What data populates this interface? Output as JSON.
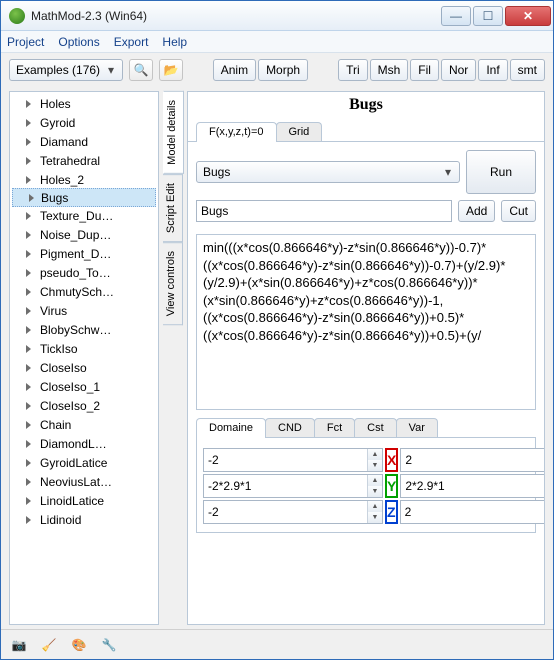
{
  "window": {
    "title": "MathMod-2.3 (Win64)"
  },
  "menu": {
    "project": "Project",
    "options": "Options",
    "export": "Export",
    "help": "Help"
  },
  "toolbar": {
    "examples_label": "Examples (176)",
    "anim": "Anim",
    "morph": "Morph",
    "tri": "Tri",
    "msh": "Msh",
    "fil": "Fil",
    "nor": "Nor",
    "inf": "Inf",
    "smt": "smt"
  },
  "tree": {
    "items": [
      "Holes",
      "Gyroid",
      "Diamand",
      "Tetrahedral",
      "Holes_2",
      "Bugs",
      "Texture_Du…",
      "Noise_Dup…",
      "Pigment_D…",
      "pseudo_To…",
      "ChmutySch…",
      "Virus",
      "BlobySchw…",
      "TickIso",
      "CloseIso",
      "CloseIso_1",
      "CloseIso_2",
      "Chain",
      "DiamondL…",
      "GyroidLatice",
      "NeoviusLat…",
      "LinoidLatice",
      "Lidinoid"
    ],
    "selected_index": 5
  },
  "sidetabs": {
    "model_details": "Model details",
    "script_edit": "Script Edit",
    "view_controls": "View controls"
  },
  "panel": {
    "title": "Bugs",
    "fxyz_tab": "F(x,y,z,t)=0",
    "grid_tab": "Grid",
    "shape_select": "Bugs",
    "run": "Run",
    "name_input": "Bugs",
    "add": "Add",
    "cut": "Cut",
    "formula": "min(((x*cos(0.866646*y)-z*sin(0.866646*y))-0.7)*((x*cos(0.866646*y)-z*sin(0.866646*y))-0.7)+(y/2.9)*(y/2.9)+(x*sin(0.866646*y)+z*cos(0.866646*y))*(x*sin(0.866646*y)+z*cos(0.866646*y))-1, ((x*cos(0.866646*y)-z*sin(0.866646*y))+0.5)*((x*cos(0.866646*y)-z*sin(0.866646*y))+0.5)+(y/",
    "domain_tabs": {
      "domaine": "Domaine",
      "cnd": "CND",
      "fct": "Fct",
      "cst": "Cst",
      "var": "Var"
    },
    "domain": {
      "x": {
        "min": "-2",
        "max": "2",
        "label": "X"
      },
      "y": {
        "min": "-2*2.9*1",
        "max": "2*2.9*1",
        "label": "Y"
      },
      "z": {
        "min": "-2",
        "max": "2",
        "label": "Z"
      }
    }
  }
}
